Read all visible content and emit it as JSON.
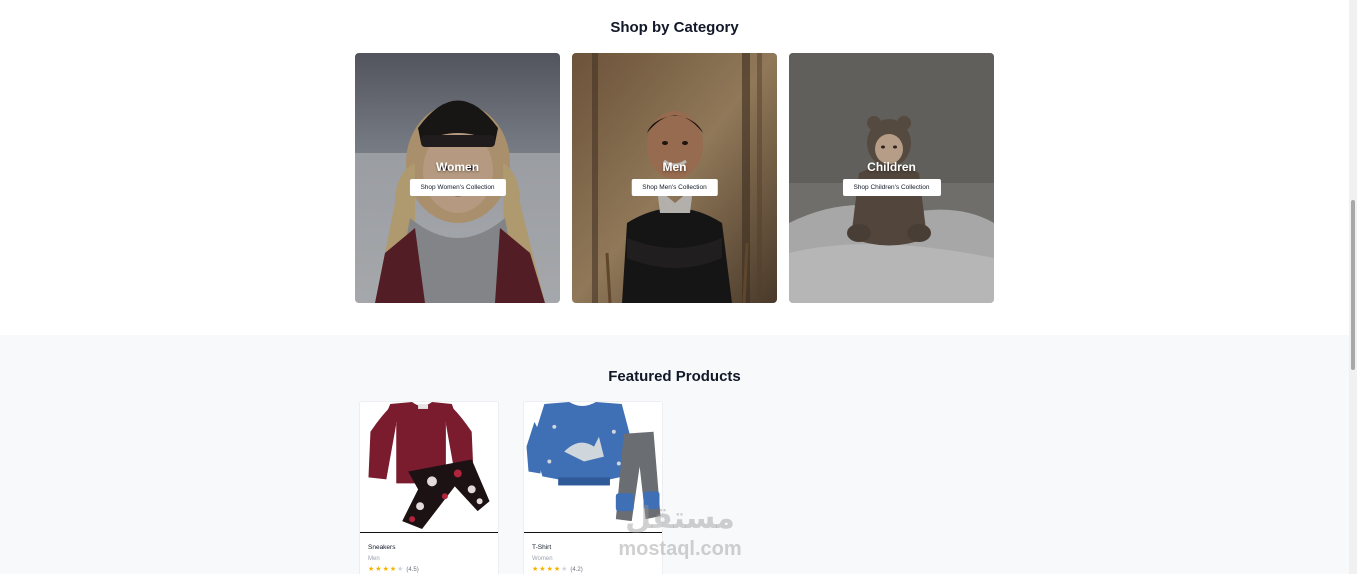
{
  "categories_section": {
    "title": "Shop by Category",
    "items": [
      {
        "name": "Women",
        "button_label": "Shop Women's Collection"
      },
      {
        "name": "Men",
        "button_label": "Shop Men's Collection"
      },
      {
        "name": "Children",
        "button_label": "Shop Children's Collection"
      }
    ]
  },
  "featured_section": {
    "title": "Featured Products",
    "products": [
      {
        "name": "Sneakers",
        "category": "Men",
        "rating": 4.5,
        "rating_label": "(4.5)"
      },
      {
        "name": "T-Shirt",
        "category": "Women",
        "rating": 4.2,
        "rating_label": "(4.2)"
      }
    ]
  },
  "watermark": {
    "arabic": "مستقل",
    "latin": "mostaql.com"
  },
  "colors": {
    "star": "#f5b301",
    "background_alt": "#f8f9fb",
    "text": "#111827"
  }
}
